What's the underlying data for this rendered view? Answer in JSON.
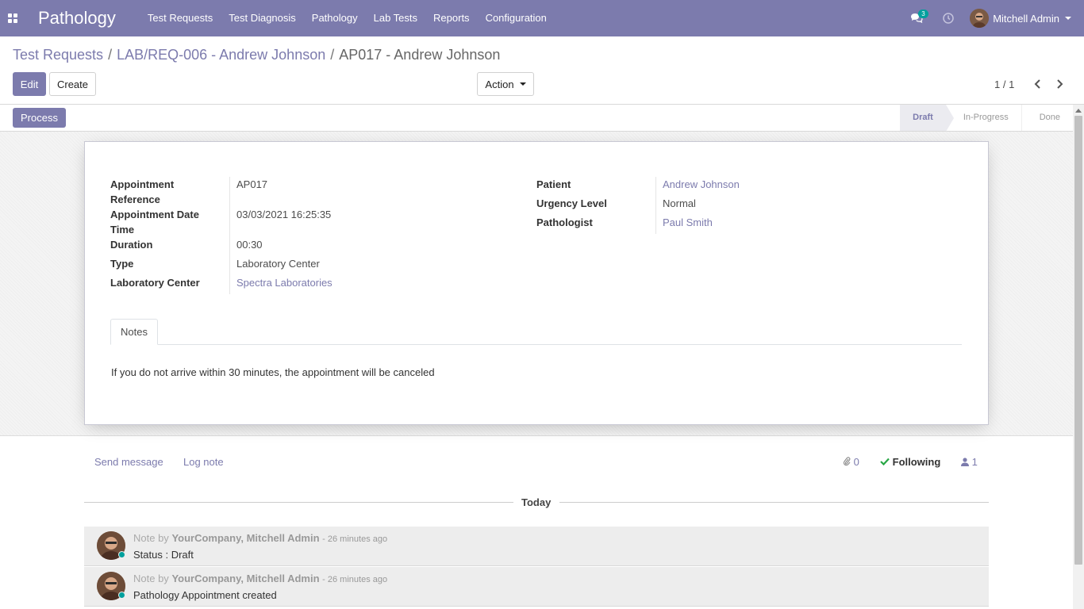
{
  "navbar": {
    "brand": "Pathology",
    "menu": [
      "Test Requests",
      "Test Diagnosis",
      "Pathology",
      "Lab Tests",
      "Reports",
      "Configuration"
    ],
    "chat_count": "3",
    "user_name": "Mitchell Admin",
    "color": "#7c7bad"
  },
  "breadcrumb": {
    "items": [
      "Test Requests",
      "LAB/REQ-006 - Andrew Johnson"
    ],
    "separator": "/",
    "active": "AP017 - Andrew Johnson"
  },
  "toolbar": {
    "edit_label": "Edit",
    "create_label": "Create",
    "action_label": "Action",
    "pager": "1 / 1"
  },
  "statusbar": {
    "process_label": "Process",
    "stages": [
      "Draft",
      "In-Progress",
      "Done"
    ],
    "current_stage": "Draft"
  },
  "form": {
    "left": [
      {
        "label": "Appointment Reference",
        "value": "AP017"
      },
      {
        "label": "Appointment Date Time",
        "value": "03/03/2021 16:25:35"
      },
      {
        "label": "Duration",
        "value": "00:30"
      },
      {
        "label": "Type",
        "value": "Laboratory Center"
      },
      {
        "label": "Laboratory Center",
        "value": "Spectra Laboratories"
      }
    ],
    "right": [
      {
        "label": "Patient",
        "value": "Andrew Johnson"
      },
      {
        "label": "Urgency Level",
        "value": "Normal"
      },
      {
        "label": "Pathologist",
        "value": "Paul Smith"
      }
    ],
    "tab_label": "Notes",
    "notes": "If you do not arrive within 30 minutes, the appointment will be canceled"
  },
  "chatter": {
    "send_message": "Send message",
    "log_note": "Log note",
    "attachments": "0",
    "following": "Following",
    "followers": "1",
    "today": "Today",
    "messages": [
      {
        "prefix": "Note by",
        "author": "YourCompany, Mitchell Admin",
        "time": "- 26 minutes ago",
        "body": "Status : Draft"
      },
      {
        "prefix": "Note by",
        "author": "YourCompany, Mitchell Admin",
        "time": "- 26 minutes ago",
        "body": "Pathology Appointment created"
      }
    ]
  }
}
